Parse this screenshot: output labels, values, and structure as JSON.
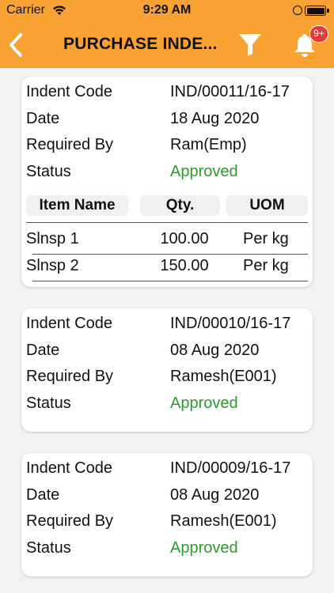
{
  "status_bar": {
    "carrier": "Carrier",
    "time": "9:29 AM"
  },
  "nav": {
    "title": "PURCHASE INDE...",
    "notification_badge": "9+",
    "icons": [
      "back-chevron-icon",
      "filter-icon",
      "bell-icon"
    ]
  },
  "colors": {
    "header": "#f7a233",
    "approved": "#2e9a2e",
    "badge": "#e53935"
  },
  "labels": {
    "indent_code": "Indent Code",
    "date": "Date",
    "required_by": "Required By",
    "status": "Status"
  },
  "table_headers": {
    "item_name": "Item Name",
    "qty": "Qty.",
    "uom": "UOM"
  },
  "indents": [
    {
      "indent_code": "IND/00011/16-17",
      "date": "18 Aug 2020",
      "required_by": "Ram(Emp)",
      "status": "Approved",
      "items": [
        {
          "name": "Slnsp 1",
          "qty": "100.00",
          "uom": "Per kg"
        },
        {
          "name": "Slnsp 2",
          "qty": "150.00",
          "uom": "Per kg"
        }
      ]
    },
    {
      "indent_code": "IND/00010/16-17",
      "date": "08 Aug 2020",
      "required_by": "Ramesh(E001)",
      "status": "Approved"
    },
    {
      "indent_code": "IND/00009/16-17",
      "date": "08 Aug 2020",
      "required_by": "Ramesh(E001)",
      "status": "Approved"
    }
  ]
}
